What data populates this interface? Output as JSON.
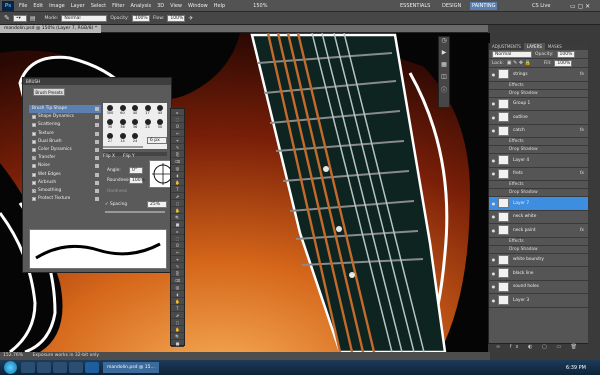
{
  "app": {
    "logo": "Ps",
    "menus": [
      "File",
      "Edit",
      "Image",
      "Layer",
      "Select",
      "Filter",
      "Analysis",
      "3D",
      "View",
      "Window",
      "Help"
    ],
    "zoom_menu": "150%",
    "workspaces": [
      "ESSENTIALS",
      "DESIGN",
      "PAINTING"
    ],
    "active_workspace": "PAINTING",
    "cslive": "CS Live"
  },
  "options": {
    "mode_label": "Mode:",
    "mode": "Normal",
    "opacity_label": "Opacity:",
    "opacity": "100%",
    "flow_label": "Flow:",
    "flow": "100%"
  },
  "document": {
    "tab": "mandolin.psd @ 150% (Layer 7, RGB/8) *"
  },
  "brush_panel": {
    "header": "BRUSH",
    "preset_button": "Brush Presets",
    "items": [
      {
        "label": "Brush Tip Shape",
        "selected": true
      },
      {
        "label": "Shape Dynamics"
      },
      {
        "label": "Scattering"
      },
      {
        "label": "Texture"
      },
      {
        "label": "Dual Brush"
      },
      {
        "label": "Color Dynamics"
      },
      {
        "label": "Transfer",
        "checked": true
      },
      {
        "label": "Noise"
      },
      {
        "label": "Wet Edges"
      },
      {
        "label": "Airbrush"
      },
      {
        "label": "Smoothing",
        "checked": true
      },
      {
        "label": "Protect Texture"
      }
    ],
    "tips": [
      "300",
      "60",
      "40",
      "17",
      "45",
      "30",
      "36",
      "36",
      "25",
      "50",
      "27",
      "14",
      "24"
    ],
    "size_label": "Size",
    "size": "6 px",
    "flipx": "Flip X",
    "flipy": "Flip Y",
    "angle_label": "Angle:",
    "angle": "0°",
    "roundness_label": "Roundness:",
    "roundness": "100%",
    "hardness_label": "Hardness",
    "spacing_label": "Spacing",
    "spacing": "25%"
  },
  "layers_panel": {
    "tabs": [
      "ADJUSTMENTS",
      "LAYERS",
      "MASKS"
    ],
    "active_tab": "LAYERS",
    "blend": "Normal",
    "opacity_label": "Opacity:",
    "opacity": "100%",
    "lock_label": "Lock:",
    "fill_label": "Fill:",
    "fill": "100%",
    "rows": [
      {
        "type": "layer",
        "name": "strings",
        "fx": true
      },
      {
        "type": "sub",
        "name": "Effects"
      },
      {
        "type": "sub",
        "name": "Drop Shadow"
      },
      {
        "type": "layer",
        "name": "Group 1"
      },
      {
        "type": "layer",
        "name": "outline"
      },
      {
        "type": "layer",
        "name": "catch",
        "fx": true
      },
      {
        "type": "sub",
        "name": "Effects"
      },
      {
        "type": "sub",
        "name": "Drop Shadow"
      },
      {
        "type": "layer",
        "name": "Layer 4"
      },
      {
        "type": "layer",
        "name": "frets",
        "fx": true
      },
      {
        "type": "sub",
        "name": "Effects"
      },
      {
        "type": "sub",
        "name": "Drop Shadow"
      },
      {
        "type": "layer",
        "name": "Layer 7",
        "selected": true
      },
      {
        "type": "layer",
        "name": "neck white"
      },
      {
        "type": "layer",
        "name": "neck paint",
        "fx": true
      },
      {
        "type": "sub",
        "name": "Effects"
      },
      {
        "type": "sub",
        "name": "Drop Shadow"
      },
      {
        "type": "layer",
        "name": "white boundry"
      },
      {
        "type": "layer",
        "name": "black line"
      },
      {
        "type": "layer",
        "name": "sound holes"
      },
      {
        "type": "layer",
        "name": "Layer 3"
      }
    ],
    "fx_label": "fx"
  },
  "status": {
    "zoom": "152.76%",
    "info": "Exposure works in 32-bit only"
  },
  "taskbar": {
    "task": "mandolin.psd @ 15...",
    "time": "6:39 PM"
  },
  "colors": {
    "ui_bg": "#535353",
    "accent": "#3d8de0",
    "fretboard": "#0d2420",
    "body": "#b84a10"
  }
}
